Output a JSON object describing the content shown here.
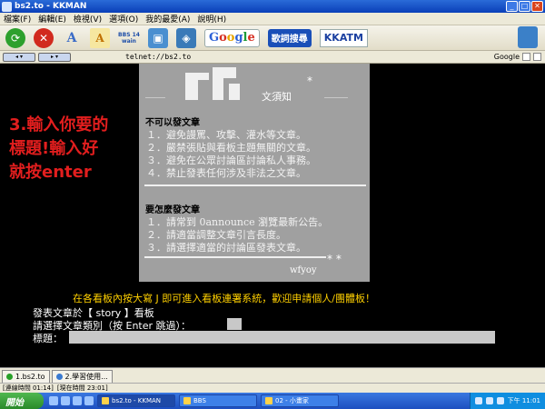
{
  "window": {
    "title": "bs2.to - KKMAN",
    "min": "_",
    "max": "□",
    "close": "✕"
  },
  "menu": [
    "檔案(F)",
    "編輯(E)",
    "檢視(V)",
    "選項(O)",
    "我的最愛(A)",
    "說明(H)"
  ],
  "toolbar": {
    "font_large": "A",
    "font_small": "A",
    "bbs_label": "BBS 14 wain",
    "google": [
      "G",
      "o",
      "o",
      "g",
      "l",
      "e"
    ],
    "lyrics": "歌詞搜尋",
    "kkatm": "KKATM"
  },
  "address": {
    "value": "telnet://bs2.to",
    "search_engine": "Google"
  },
  "notice": {
    "title": "文須知",
    "stars_top": "*",
    "section1_title": "不可以發文章",
    "section1_items": [
      "１．避免謾罵、攻擊、灌水等文章。",
      "２．嚴禁張貼與看板主題無關的文章。",
      "３．避免在公眾討論區討論私人事務。",
      "４．禁止發表任何涉及非法之文章。"
    ],
    "section2_title": "要怎麼發文章",
    "section2_items": [
      "１．請常到 0announce 瀏覽最新公告。",
      "２．請適當調整文章引言長度。",
      "３．請選擇適當的討論區發表文章。"
    ],
    "signature": "wfyoy",
    "stars_bottom": "*  *"
  },
  "instruction": {
    "line1": "3.輸入你要的",
    "line2": "標題!輸入好",
    "line3": "就按enter"
  },
  "terminal": {
    "yellow_line": "在各看板內按大寫 J 即可進入看板連署系統，歡迎申請個人/團體板！",
    "post_in": "發表文章於【 story 】看板",
    "choose_category": "請選擇文章類別（按 Enter 跳過）：",
    "title_label": "標題："
  },
  "tabs": [
    {
      "label": "1.bs2.to"
    },
    {
      "label": "2.學習使用..."
    }
  ],
  "status": {
    "online": "[連線時間 01:14]",
    "now": "[現在時間 23:01]"
  },
  "taskbar": {
    "start": "開始",
    "tasks": [
      {
        "label": "bs2.to - KKMAN"
      },
      {
        "label": "BBS"
      },
      {
        "label": "02 - 小畫家"
      }
    ],
    "clock": "下午 11:01"
  }
}
